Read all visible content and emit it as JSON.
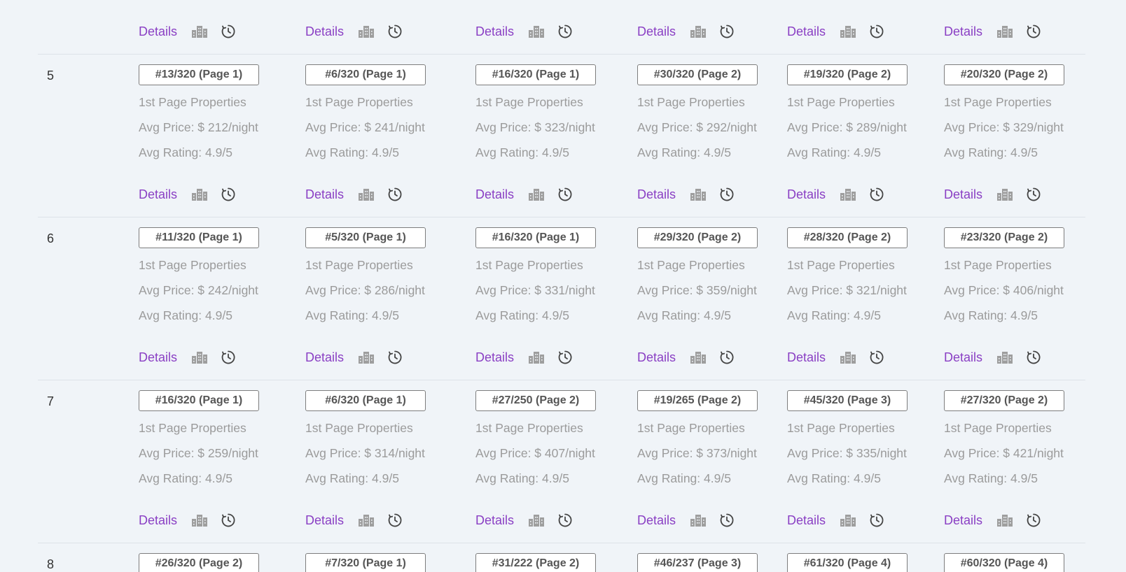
{
  "labels": {
    "details": "Details",
    "building_icon": "building-icon",
    "history_icon": "clock-history-icon"
  },
  "colors": {
    "background": "#f0f4f8",
    "link": "#8a3fc4",
    "muted_text": "#9b9b9b",
    "divider": "#dde2e8",
    "badge_border": "#7d7d7d",
    "icon": "#9e9e9e"
  },
  "rows": [
    {
      "number": "5",
      "cells": [
        {
          "rank": "#13/320 (Page 1)",
          "properties": "1st Page Properties",
          "price": "Avg Price: $ 212/night",
          "rating": "Avg Rating: 4.9/5"
        },
        {
          "rank": "#6/320 (Page 1)",
          "properties": "1st Page Properties",
          "price": "Avg Price: $ 241/night",
          "rating": "Avg Rating: 4.9/5"
        },
        {
          "rank": "#16/320 (Page 1)",
          "properties": "1st Page Properties",
          "price": "Avg Price: $ 323/night",
          "rating": "Avg Rating: 4.9/5"
        },
        {
          "rank": "#30/320 (Page 2)",
          "properties": "1st Page Properties",
          "price": "Avg Price: $ 292/night",
          "rating": "Avg Rating: 4.9/5"
        },
        {
          "rank": "#19/320 (Page 2)",
          "properties": "1st Page Properties",
          "price": "Avg Price: $ 289/night",
          "rating": "Avg Rating: 4.9/5"
        },
        {
          "rank": "#20/320 (Page 2)",
          "properties": "1st Page Properties",
          "price": "Avg Price: $ 329/night",
          "rating": "Avg Rating: 4.9/5"
        }
      ]
    },
    {
      "number": "6",
      "cells": [
        {
          "rank": "#11/320 (Page 1)",
          "properties": "1st Page Properties",
          "price": "Avg Price: $ 242/night",
          "rating": "Avg Rating: 4.9/5"
        },
        {
          "rank": "#5/320 (Page 1)",
          "properties": "1st Page Properties",
          "price": "Avg Price: $ 286/night",
          "rating": "Avg Rating: 4.9/5"
        },
        {
          "rank": "#16/320 (Page 1)",
          "properties": "1st Page Properties",
          "price": "Avg Price: $ 331/night",
          "rating": "Avg Rating: 4.9/5"
        },
        {
          "rank": "#29/320 (Page 2)",
          "properties": "1st Page Properties",
          "price": "Avg Price: $ 359/night",
          "rating": "Avg Rating: 4.9/5"
        },
        {
          "rank": "#28/320 (Page 2)",
          "properties": "1st Page Properties",
          "price": "Avg Price: $ 321/night",
          "rating": "Avg Rating: 4.9/5"
        },
        {
          "rank": "#23/320 (Page 2)",
          "properties": "1st Page Properties",
          "price": "Avg Price: $ 406/night",
          "rating": "Avg Rating: 4.9/5"
        }
      ]
    },
    {
      "number": "7",
      "cells": [
        {
          "rank": "#16/320 (Page 1)",
          "properties": "1st Page Properties",
          "price": "Avg Price: $ 259/night",
          "rating": "Avg Rating: 4.9/5"
        },
        {
          "rank": "#6/320 (Page 1)",
          "properties": "1st Page Properties",
          "price": "Avg Price: $ 314/night",
          "rating": "Avg Rating: 4.9/5"
        },
        {
          "rank": "#27/250 (Page 2)",
          "properties": "1st Page Properties",
          "price": "Avg Price: $ 407/night",
          "rating": "Avg Rating: 4.9/5"
        },
        {
          "rank": "#19/265 (Page 2)",
          "properties": "1st Page Properties",
          "price": "Avg Price: $ 373/night",
          "rating": "Avg Rating: 4.9/5"
        },
        {
          "rank": "#45/320 (Page 3)",
          "properties": "1st Page Properties",
          "price": "Avg Price: $ 335/night",
          "rating": "Avg Rating: 4.9/5"
        },
        {
          "rank": "#27/320 (Page 2)",
          "properties": "1st Page Properties",
          "price": "Avg Price: $ 421/night",
          "rating": "Avg Rating: 4.9/5"
        }
      ]
    },
    {
      "number": "8",
      "cells": [
        {
          "rank": "#26/320 (Page 2)"
        },
        {
          "rank": "#7/320 (Page 1)"
        },
        {
          "rank": "#31/222 (Page 2)"
        },
        {
          "rank": "#46/237 (Page 3)"
        },
        {
          "rank": "#61/320 (Page 4)"
        },
        {
          "rank": "#60/320 (Page 4)"
        }
      ]
    }
  ]
}
